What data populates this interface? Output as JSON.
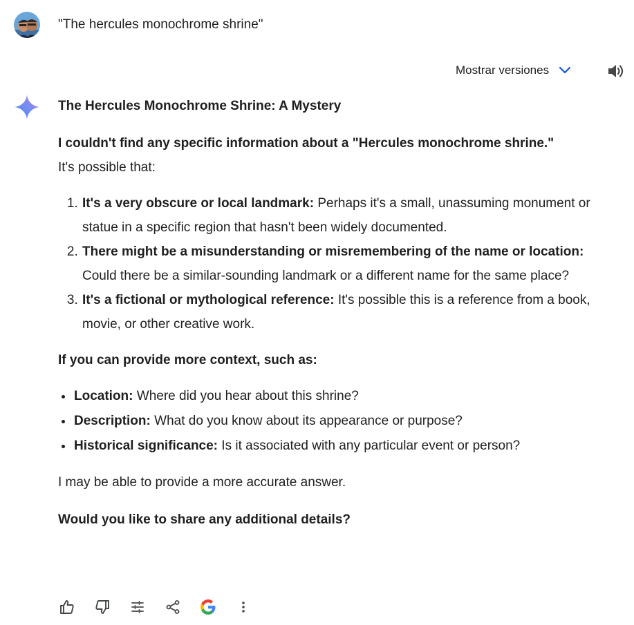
{
  "user": {
    "prompt": "\"The hercules monochrome shrine\""
  },
  "header": {
    "versions_label": "Mostrar versiones",
    "accent": "#0b57d0"
  },
  "response": {
    "title": "The Hercules Monochrome Shrine: A Mystery",
    "intro_bold": "I couldn't find any specific information about a \"Hercules monochrome shrine.\"",
    "intro_rest": "It's possible that:",
    "reasons": [
      {
        "bold": "It's a very obscure or local landmark:",
        "text": " Perhaps it's a small, unassuming monument or statue in a specific region that hasn't been widely documented."
      },
      {
        "bold": "There might be a misunderstanding or misremembering of the name or location:",
        "text": " Could there be a similar-sounding landmark or a different name for the same place?"
      },
      {
        "bold": "It's a fictional or mythological reference:",
        "text": " It's possible this is a reference from a book, movie, or other creative work."
      }
    ],
    "ask_heading": "If you can provide more context, such as:",
    "context_items": [
      {
        "bold": "Location:",
        "text": " Where did you hear about this shrine?"
      },
      {
        "bold": "Description:",
        "text": " What do you know about its appearance or purpose?"
      },
      {
        "bold": "Historical significance:",
        "text": " Is it associated with any particular event or person?"
      }
    ],
    "closing": "I may be able to provide a more accurate answer.",
    "question": "Would you like to share any additional details?"
  },
  "toolbar": {
    "icons": [
      "thumbs-up-icon",
      "thumbs-down-icon",
      "tune-icon",
      "share-icon",
      "google-icon",
      "more-vert-icon"
    ]
  }
}
